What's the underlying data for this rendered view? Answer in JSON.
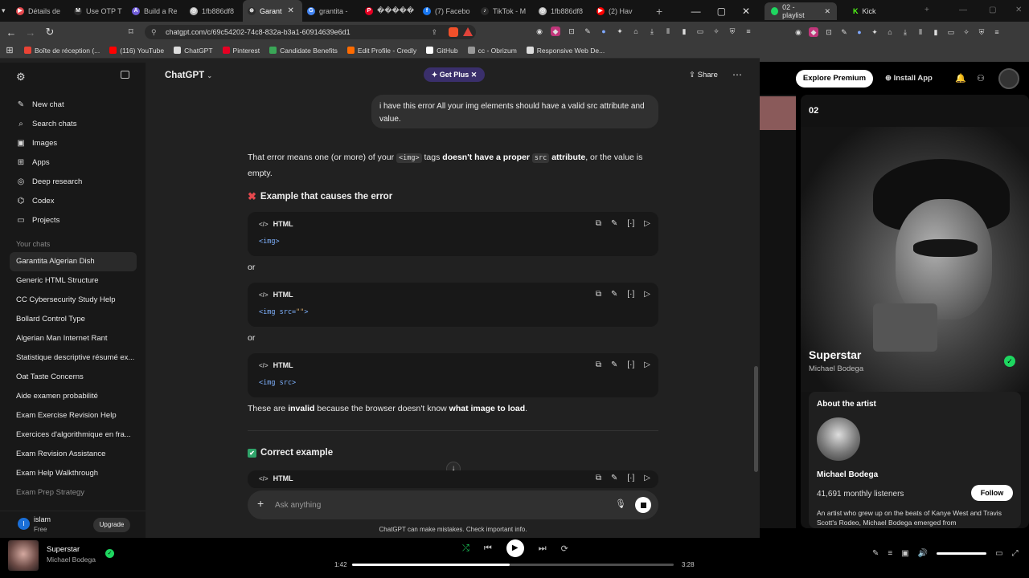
{
  "browser_left": {
    "tabs": [
      {
        "label": "Détails de",
        "fav_color": "#e5484d",
        "fav_glyph": "▶"
      },
      {
        "label": "Use OTP T",
        "fav_color": "#ffffff",
        "fav_glyph": "M"
      },
      {
        "label": "Build a Re",
        "fav_color": "#6e5bd6",
        "fav_glyph": "A"
      },
      {
        "label": "1fb886df8",
        "fav_color": "#bbbbbb",
        "fav_glyph": "◎"
      },
      {
        "label": "Garant",
        "fav_color": "#ffffff",
        "fav_glyph": "⊛",
        "active": true
      },
      {
        "label": "grantita -",
        "fav_color": "#4285f4",
        "fav_glyph": "G"
      },
      {
        "label": "�����",
        "fav_color": "#e60023",
        "fav_glyph": "P"
      },
      {
        "label": "(7) Facebo",
        "fav_color": "#1877f2",
        "fav_glyph": "f"
      },
      {
        "label": "TikTok - M",
        "fav_color": "#ffffff",
        "fav_glyph": "♪"
      },
      {
        "label": "1fb886df8",
        "fav_color": "#bbbbbb",
        "fav_glyph": "◎"
      },
      {
        "label": "(2) Hav",
        "fav_color": "#ff0000",
        "fav_glyph": "▶"
      }
    ],
    "url": "chatgpt.com/c/69c54202-74c8-832a-b3a1-60914639e6d1",
    "bookmarks": [
      {
        "label": "Boîte de réception (...",
        "color": "#ea4335"
      },
      {
        "label": "(116) YouTube",
        "color": "#ff0000"
      },
      {
        "label": "ChatGPT",
        "color": "#dddddd"
      },
      {
        "label": "Pinterest",
        "color": "#e60023"
      },
      {
        "label": "Candidate Benefits",
        "color": "#3aa757"
      },
      {
        "label": "Edit Profile - Credly",
        "color": "#ff6b00"
      },
      {
        "label": "GitHub",
        "color": "#ffffff"
      },
      {
        "label": "cc - Obrizum",
        "color": "#999999"
      },
      {
        "label": "Responsive Web De...",
        "color": "#dddddd"
      }
    ]
  },
  "sidebar": {
    "nav": [
      {
        "label": "New chat",
        "icon": "✎"
      },
      {
        "label": "Search chats",
        "icon": "⌕"
      },
      {
        "label": "Images",
        "icon": "▣"
      },
      {
        "label": "Apps",
        "icon": "⊞"
      },
      {
        "label": "Deep research",
        "icon": "◎"
      },
      {
        "label": "Codex",
        "icon": "⌬"
      },
      {
        "label": "Projects",
        "icon": "▭"
      }
    ],
    "section_title": "Your chats",
    "chats": [
      "Garantita Algerian Dish",
      "Generic HTML Structure",
      "CC Cybersecurity Study Help",
      "Bollard Control Type",
      "Algerian Man Internet Rant",
      "Statistique descriptive résumé ex...",
      "Oat Taste Concerns",
      "Aide examen probabilité",
      "Exam Exercise Revision Help",
      "Exercices d'algorithmique en fra...",
      "Exam Revision Assistance",
      "Exam Help Walkthrough",
      "Exam Prep Strategy"
    ],
    "user": {
      "initial": "I",
      "name": "islam",
      "plan": "Free",
      "upgrade": "Upgrade"
    }
  },
  "main": {
    "title": "ChatGPT",
    "get_plus": "Get Plus",
    "share": "Share",
    "user_message": "i have this error  All your img elements should have a valid src attribute and value.",
    "p1": {
      "t1": "That error means one (or more) of your ",
      "code1": "<img>",
      "t2": " tags ",
      "b1": "doesn't have a proper",
      "code2": "src",
      "b2": "attribute",
      "t3": ", or the value is empty."
    },
    "h_bad": "Example that causes the error",
    "code_lang": "HTML",
    "code_blocks": [
      {
        "pre": "<img>",
        "str": "",
        "post": ""
      },
      {
        "pre": "<img src=",
        "str": "\"\"",
        "post": ">"
      },
      {
        "pre": "<img src>",
        "str": "",
        "post": ""
      }
    ],
    "or": "or",
    "p2": {
      "t1": "These are ",
      "b1": "invalid",
      "t2": " because the browser doesn't know ",
      "b2": "what image to load",
      "t3": "."
    },
    "h_good": "Correct example",
    "composer_placeholder": "Ask anything",
    "disclaimer": "ChatGPT can make mistakes. Check important info."
  },
  "browser_right": {
    "tabs": [
      {
        "label": "02 - playlist",
        "color": "#1ed760"
      },
      {
        "label": "Kick",
        "color": "#53fc18"
      }
    ],
    "explore": "Explore Premium",
    "install": "Install App",
    "now_playing_label": "02",
    "track": "Superstar",
    "artist": "Michael Bodega",
    "about_heading": "About the artist",
    "about_name": "Michael Bodega",
    "listeners": "41,691 monthly listeners",
    "follow": "Follow",
    "bio": "An artist who grew up on the beats of Kanye West and Travis Scott's Rodeo, Michael Bodega emerged from"
  },
  "player": {
    "track": "Superstar",
    "artist": "Michael Bodega",
    "elapsed": "1:42",
    "duration": "3:28",
    "progress": 0.49,
    "accent": "#1ed760"
  }
}
